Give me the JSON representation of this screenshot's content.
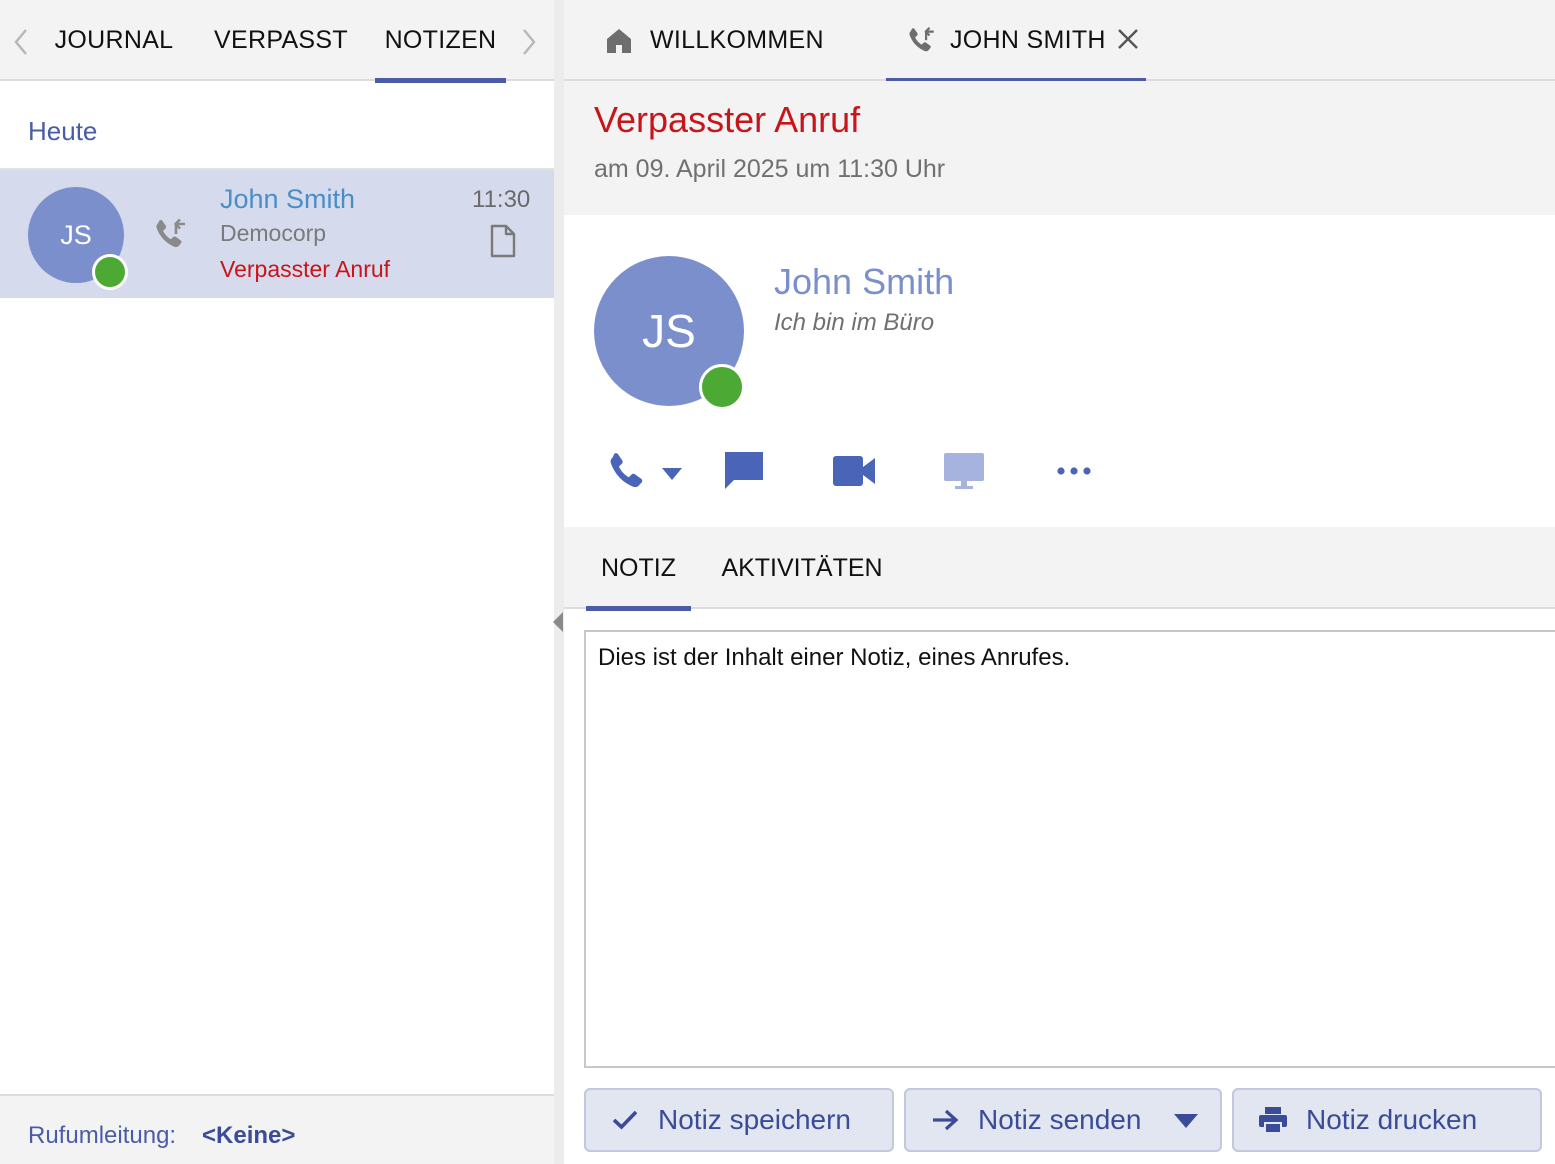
{
  "left_tabs": {
    "journal": "JOURNAL",
    "verpasst": "VERPASST",
    "notizen": "NOTIZEN"
  },
  "journal": {
    "section_title": "Heute",
    "items": [
      {
        "initials": "JS",
        "name": "John Smith",
        "company": "Democorp",
        "status": "Verpasster Anruf",
        "time": "11:30"
      }
    ]
  },
  "footer": {
    "label": "Rufumleitung:",
    "value": "<Keine>"
  },
  "right_tabs": {
    "welcome": "WILLKOMMEN",
    "contact": "JOHN SMITH"
  },
  "call": {
    "title": "Verpasster Anruf",
    "date": "am 09. April 2025 um 11:30 Uhr"
  },
  "contact": {
    "initials": "JS",
    "name": "John Smith",
    "status_message": "Ich bin im Büro"
  },
  "note_tabs": {
    "note": "NOTIZ",
    "activities": "AKTIVITÄTEN"
  },
  "note": {
    "content": "Dies ist der Inhalt einer Notiz, eines Anrufes."
  },
  "buttons": {
    "save": "Notiz speichern",
    "send": "Notiz senden",
    "print": "Notiz drucken"
  },
  "colors": {
    "accent": "#4a5ca8",
    "avatar": "#7b8fcc",
    "missed": "#c8151b",
    "presence_available": "#4caa34",
    "selected_row": "#d5dbec"
  }
}
